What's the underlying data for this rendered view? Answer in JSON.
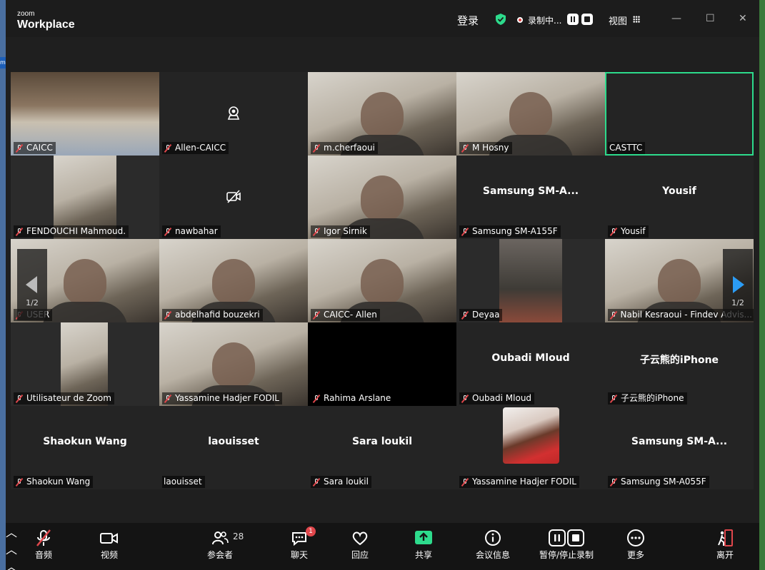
{
  "app": {
    "brand_small": "zoom",
    "brand_big": "Workplace"
  },
  "titlebar": {
    "login": "登录",
    "recording_status": "录制中...",
    "view": "视图",
    "window_controls": [
      "minimize-icon",
      "maximize-icon",
      "close-icon"
    ],
    "shield_color": "#2ddb8c"
  },
  "gallery": {
    "page_left": "1/2",
    "page_right": "1/2",
    "tiles": [
      {
        "label": "CAICC",
        "muted": true,
        "video": true,
        "scene": "conference-room"
      },
      {
        "label": "Allen-CAICC",
        "muted": true,
        "video": false,
        "icon": "camera-icon"
      },
      {
        "label": "m.cherfaoui",
        "muted": true,
        "video": true,
        "scene": "person"
      },
      {
        "label": "M Hosny",
        "muted": true,
        "video": true,
        "scene": "person"
      },
      {
        "label": "CASTTC",
        "muted": false,
        "video": false,
        "active": true,
        "display": ""
      },
      {
        "label": "FENDOUCHI Mahmoud.",
        "muted": true,
        "video": true,
        "scene": "person"
      },
      {
        "label": "nawbahar",
        "muted": true,
        "video": false,
        "icon": "camera-off-icon"
      },
      {
        "label": "Igor Sirnik",
        "muted": true,
        "video": true,
        "scene": "person"
      },
      {
        "label": "Samsung SM-A155F",
        "muted": true,
        "video": false,
        "display": "Samsung  SM-A..."
      },
      {
        "label": "Yousif",
        "muted": true,
        "video": false,
        "display": "Yousif"
      },
      {
        "label": "USER",
        "muted": true,
        "video": true,
        "scene": "person"
      },
      {
        "label": "abdelhafid bouzekri",
        "muted": true,
        "video": true,
        "scene": "person"
      },
      {
        "label": "CAICC- Allen",
        "muted": true,
        "video": true,
        "scene": "person"
      },
      {
        "label": "Deyaa",
        "muted": true,
        "video": true,
        "scene": "room"
      },
      {
        "label": "Nabil Kesraoui - Findev Advis...",
        "muted": true,
        "video": true,
        "scene": "person"
      },
      {
        "label": "Utilisateur de Zoom",
        "muted": true,
        "video": true,
        "scene": "person"
      },
      {
        "label": "Yassamine Hadjer FODIL",
        "muted": true,
        "video": true,
        "scene": "person"
      },
      {
        "label": "Rahima Arslane",
        "muted": true,
        "video": true,
        "scene": "black"
      },
      {
        "label": "Oubadi Mloud",
        "muted": true,
        "video": false,
        "display": "Oubadi Mloud"
      },
      {
        "label": "子云熊的iPhone",
        "muted": true,
        "video": false,
        "display": "子云熊的iPhone"
      },
      {
        "label": "Shaokun Wang",
        "muted": true,
        "video": false,
        "display": "Shaokun Wang"
      },
      {
        "label": "laouisset",
        "muted": false,
        "video": false,
        "display": "laouisset"
      },
      {
        "label": "Sara loukil",
        "muted": true,
        "video": false,
        "display": "Sara loukil"
      },
      {
        "label": "Yassamine Hadjer FODIL",
        "muted": true,
        "video": false,
        "avatar": true
      },
      {
        "label": "Samsung SM-A055F",
        "muted": true,
        "video": false,
        "display": "Samsung  SM-A..."
      }
    ]
  },
  "toolbar": {
    "audio": "音频",
    "video": "视频",
    "participants": "参会者",
    "participants_count": "28",
    "chat": "聊天",
    "chat_badge": "1",
    "react": "回应",
    "share": "共享",
    "info": "会议信息",
    "record": "暂停/停止录制",
    "more": "更多",
    "leave": "离开",
    "share_color": "#2ddb8c",
    "leave_color": "#e0474c"
  }
}
